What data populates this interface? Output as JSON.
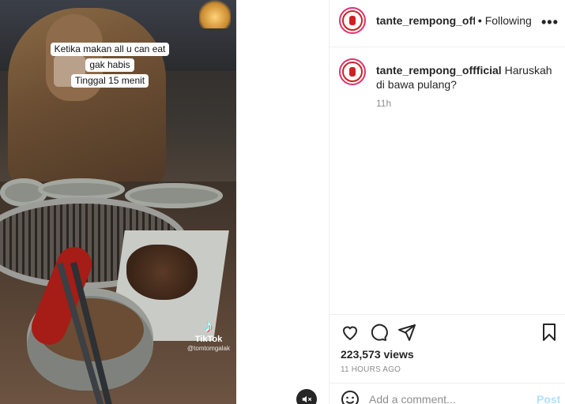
{
  "video": {
    "caption_lines": [
      "Ketika makan all u can eat",
      "gak habis",
      "Tinggal 15 menit"
    ],
    "watermark_brand": "TikTok",
    "watermark_user": "@tomtomgalak",
    "mute_icon": "muted-speaker-icon"
  },
  "header": {
    "username": "tante_rempong_offficial",
    "separator": "•",
    "follow_status": "Following",
    "more_icon": "more-options-icon"
  },
  "comment": {
    "username": "tante_rempong_offficial",
    "text": "Haruskah di bawa pulang?",
    "time": "11h"
  },
  "actions": {
    "icons": [
      "heart-icon",
      "comment-icon",
      "share-icon",
      "bookmark-icon"
    ],
    "views": "223,573 views",
    "posted_ago": "11 HOURS AGO"
  },
  "add_comment": {
    "placeholder": "Add a comment...",
    "post_label": "Post"
  },
  "colors": {
    "text_primary": "#262626",
    "text_secondary": "#8e8e8e",
    "post_disabled": "#b2dffc",
    "avatar_ring": "#e1306c"
  }
}
